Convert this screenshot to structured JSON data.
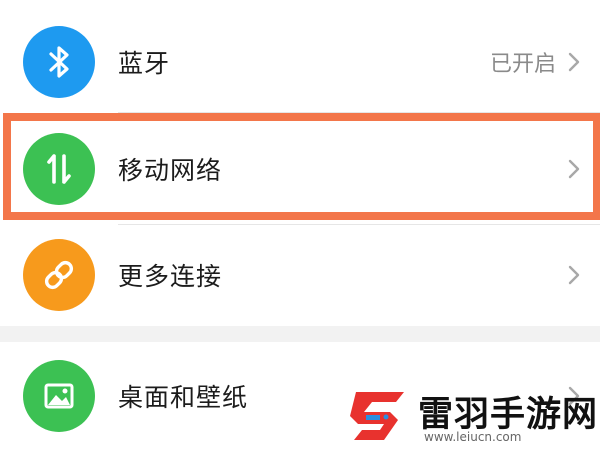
{
  "settings": {
    "items": [
      {
        "label": "蓝牙",
        "status": "已开启",
        "icon": "bluetooth-icon",
        "color": "#1e9af0"
      },
      {
        "label": "移动网络",
        "status": "",
        "icon": "mobile-data-arrows-icon",
        "color": "#3cc153"
      },
      {
        "label": "更多连接",
        "status": "",
        "icon": "link-chain-icon",
        "color": "#f79a1c"
      },
      {
        "label": "桌面和壁纸",
        "status": "",
        "icon": "picture-icon",
        "color": "#3cc153"
      }
    ],
    "chevron_icon": "chevron-right-icon"
  },
  "highlight": {
    "color": "#f3764a"
  },
  "watermark": {
    "title": "雷羽手游网",
    "url": "www.leiucn.com",
    "logo_color": "#e8322e"
  }
}
